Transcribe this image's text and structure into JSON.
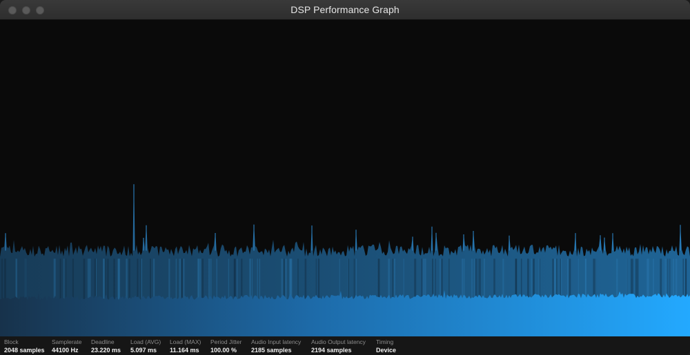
{
  "window": {
    "title": "DSP Performance Graph"
  },
  "colors": {
    "background": "#0a0a0a",
    "load_max_fill": "#1e5f8c",
    "load_avg_fill_start": "#1a3a56",
    "load_avg_fill_end": "#22a8ff",
    "accent": "#2aa8ff"
  },
  "stats": [
    {
      "label": "Block",
      "value": "2048 samples"
    },
    {
      "label": "Samplerate",
      "value": "44100 Hz"
    },
    {
      "label": "Deadline",
      "value": "23.220 ms"
    },
    {
      "label": "Load (AVG)",
      "value": "5.097 ms"
    },
    {
      "label": "Load (MAX)",
      "value": "11.164 ms"
    },
    {
      "label": "Period Jitter",
      "value": "100.00 %"
    },
    {
      "label": "Audio Input latency",
      "value": "2185 samples"
    },
    {
      "label": "Audio Output latency",
      "value": "2194 samples"
    },
    {
      "label": "Timing",
      "value": "Device"
    }
  ],
  "chart_data": {
    "type": "area",
    "ylim": [
      0,
      23.22
    ],
    "grid": false,
    "series": [
      {
        "name": "Load (MAX)",
        "typical": 6.3,
        "peak": 11.164
      },
      {
        "name": "Load (AVG)",
        "typical": 2.8,
        "peak": 3.4
      }
    ]
  }
}
